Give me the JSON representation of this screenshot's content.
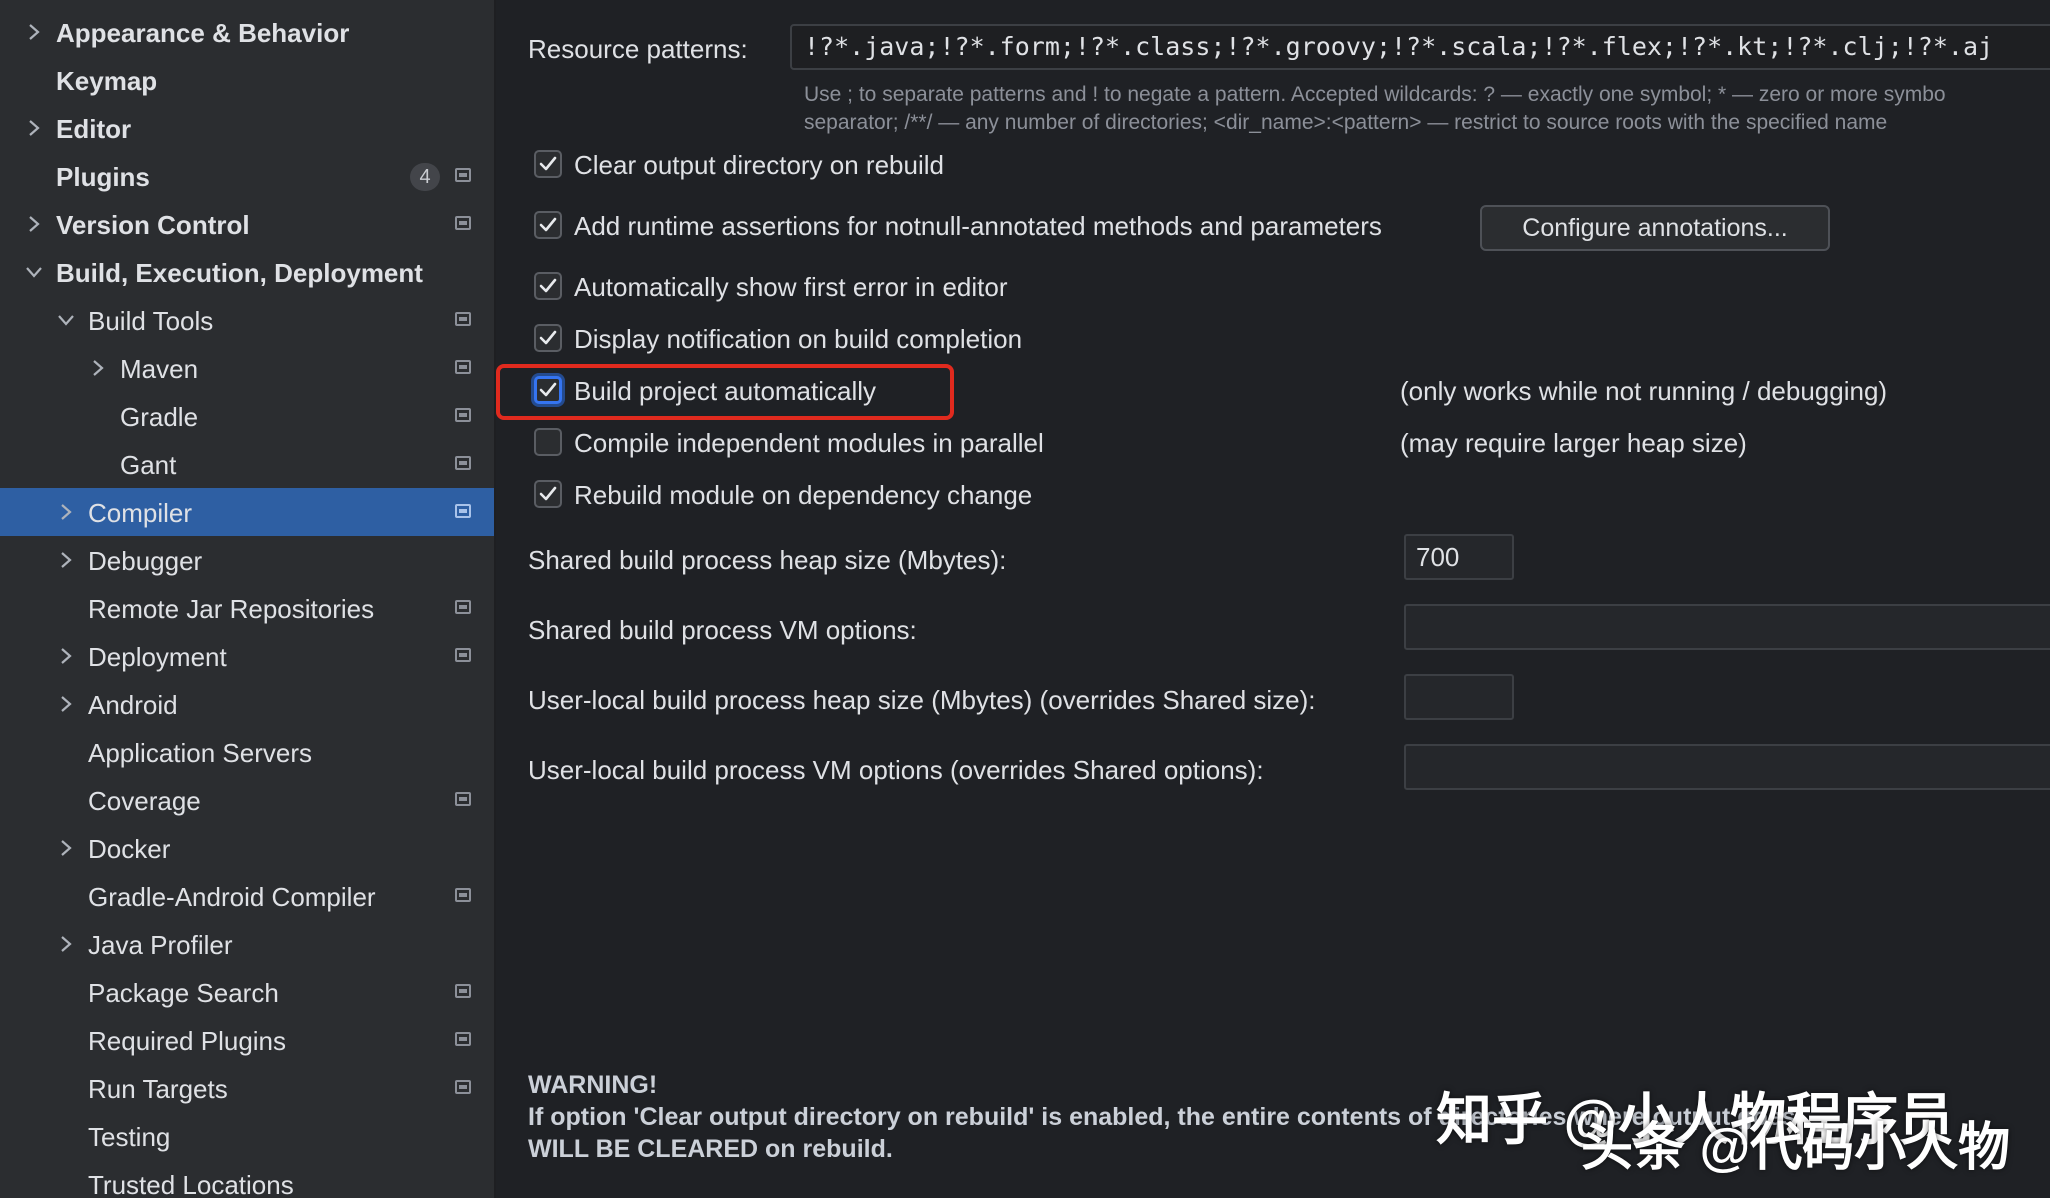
{
  "sidebar": {
    "items": [
      {
        "label": "Appearance & Behavior",
        "chevron": "right",
        "bold": true,
        "level": 0
      },
      {
        "label": "Keymap",
        "chevron": "",
        "bold": true,
        "level": 0
      },
      {
        "label": "Editor",
        "chevron": "right",
        "bold": true,
        "level": 0
      },
      {
        "label": "Plugins",
        "chevron": "",
        "bold": true,
        "level": 0,
        "badge": "4",
        "project_icon": true
      },
      {
        "label": "Version Control",
        "chevron": "right",
        "bold": true,
        "level": 0,
        "project_icon": true
      },
      {
        "label": "Build, Execution, Deployment",
        "chevron": "down",
        "bold": true,
        "level": 0
      },
      {
        "label": "Build Tools",
        "chevron": "down",
        "level": 1,
        "project_icon": true
      },
      {
        "label": "Maven",
        "chevron": "right",
        "level": 2,
        "project_icon": true
      },
      {
        "label": "Gradle",
        "chevron": "",
        "level": 2,
        "project_icon": true
      },
      {
        "label": "Gant",
        "chevron": "",
        "level": 2,
        "project_icon": true
      },
      {
        "label": "Compiler",
        "chevron": "right",
        "level": 1,
        "project_icon": true,
        "selected": true
      },
      {
        "label": "Debugger",
        "chevron": "right",
        "level": 1
      },
      {
        "label": "Remote Jar Repositories",
        "chevron": "",
        "level": 1,
        "project_icon": true
      },
      {
        "label": "Deployment",
        "chevron": "right",
        "level": 1,
        "project_icon": true
      },
      {
        "label": "Android",
        "chevron": "right",
        "level": 1
      },
      {
        "label": "Application Servers",
        "chevron": "",
        "level": 1
      },
      {
        "label": "Coverage",
        "chevron": "",
        "level": 1,
        "project_icon": true
      },
      {
        "label": "Docker",
        "chevron": "right",
        "level": 1
      },
      {
        "label": "Gradle-Android Compiler",
        "chevron": "",
        "level": 1,
        "project_icon": true
      },
      {
        "label": "Java Profiler",
        "chevron": "right",
        "level": 1
      },
      {
        "label": "Package Search",
        "chevron": "",
        "level": 1,
        "project_icon": true
      },
      {
        "label": "Required Plugins",
        "chevron": "",
        "level": 1,
        "project_icon": true
      },
      {
        "label": "Run Targets",
        "chevron": "",
        "level": 1,
        "project_icon": true
      },
      {
        "label": "Testing",
        "chevron": "",
        "level": 1
      },
      {
        "label": "Trusted Locations",
        "chevron": "",
        "level": 1
      }
    ]
  },
  "compiler": {
    "resource_patterns_label": "Resource patterns:",
    "resource_patterns_value": "!?*.java;!?*.form;!?*.class;!?*.groovy;!?*.scala;!?*.flex;!?*.kt;!?*.clj;!?*.aj",
    "hint_line1": "Use ; to separate patterns and ! to negate a pattern. Accepted wildcards: ? — exactly one symbol; * — zero or more symbo",
    "hint_line2": "separator; /**/ — any number of directories; <dir_name>:<pattern> — restrict to source roots with the specified name",
    "checkboxes": [
      {
        "label": "Clear output directory on rebuild",
        "checked": true
      },
      {
        "label": "Add runtime assertions for notnull-annotated methods and parameters",
        "checked": true
      },
      {
        "label": "Automatically show first error in editor",
        "checked": true
      },
      {
        "label": "Display notification on build completion",
        "checked": true
      },
      {
        "label": "Build project automatically",
        "checked": true,
        "note": "(only works while not running / debugging)"
      },
      {
        "label": "Compile independent modules in parallel",
        "checked": false,
        "note": "(may require larger heap size)"
      },
      {
        "label": "Rebuild module on dependency change",
        "checked": true
      }
    ],
    "configure_annotations_button": "Configure annotations...",
    "heap_size_label": "Shared build process heap size (Mbytes):",
    "heap_size_value": "700",
    "vm_options_label": "Shared build process VM options:",
    "vm_options_value": "",
    "user_heap_label": "User-local build process heap size (Mbytes) (overrides Shared size):",
    "user_heap_value": "",
    "user_vm_label": "User-local build process VM options (overrides Shared options):",
    "user_vm_value": "",
    "warning_title": "WARNING!",
    "warning_line1": "If option 'Clear output directory on rebuild' is enabled, the entire contents of directories where output goes",
    "warning_line2": "WILL BE CLEARED on rebuild."
  },
  "watermarks": {
    "zhihu": "知乎 @小人物程序员",
    "toutiao": "头条 @代码小人物"
  },
  "colors": {
    "selected_row": "#2e5fa3",
    "highlight_border": "#e02a1e",
    "focus_ring": "#3574f0"
  }
}
